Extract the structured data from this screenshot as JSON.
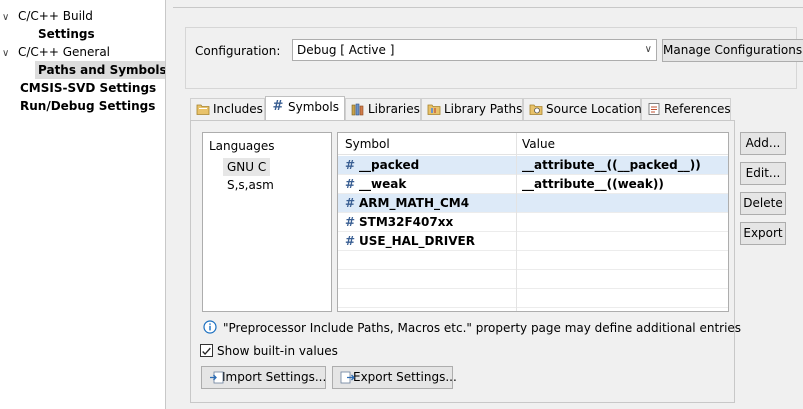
{
  "tree": {
    "items": [
      {
        "label": "C/C++ Build",
        "chevron": "expanded"
      },
      {
        "label": "Settings"
      },
      {
        "label": "C/C++ General",
        "chevron": "expanded"
      },
      {
        "label": "Paths and Symbols",
        "selected": true
      },
      {
        "label": "CMSIS-SVD Settings"
      },
      {
        "label": "Run/Debug Settings"
      }
    ]
  },
  "config": {
    "label": "Configuration:",
    "value": "Debug  [ Active ]",
    "manage_label": "Manage Configurations..."
  },
  "tabs": [
    {
      "label": "Includes",
      "icon": "includes-folder-icon"
    },
    {
      "label": "Symbols",
      "icon": "hash-icon",
      "active": true
    },
    {
      "label": "Libraries",
      "icon": "library-icon"
    },
    {
      "label": "Library Paths",
      "icon": "library-paths-icon"
    },
    {
      "label": "Source Location",
      "icon": "source-folder-icon"
    },
    {
      "label": "References",
      "icon": "references-icon"
    }
  ],
  "languages": {
    "header": "Languages",
    "items": [
      {
        "label": "GNU C",
        "selected": true
      },
      {
        "label": "S,s,asm"
      }
    ]
  },
  "symbols": {
    "header_symbol": "Symbol",
    "header_value": "Value",
    "rows": [
      {
        "hash": "#",
        "name": "__packed",
        "value": "__attribute__((__packed__))"
      },
      {
        "hash": "#",
        "name": "__weak",
        "value": "__attribute__((weak))"
      },
      {
        "hash": "#",
        "name": "ARM_MATH_CM4",
        "value": ""
      },
      {
        "hash": "#",
        "name": "STM32F407xx",
        "value": ""
      },
      {
        "hash": "#",
        "name": "USE_HAL_DRIVER",
        "value": ""
      }
    ]
  },
  "buttons": {
    "add": "Add...",
    "edit": "Edit...",
    "delete": "Delete",
    "export": "Export"
  },
  "info": {
    "text": "\"Preprocessor Include Paths, Macros etc.\" property page may define additional entries"
  },
  "show_builtin": {
    "label": "Show built-in values",
    "checked": true
  },
  "bottom_buttons": {
    "import": "Import Settings...",
    "export": "Export Settings..."
  },
  "colors": {
    "accent": "#1a6fc0",
    "selection": "#ddeaf8",
    "hash": "#3a5f93"
  }
}
